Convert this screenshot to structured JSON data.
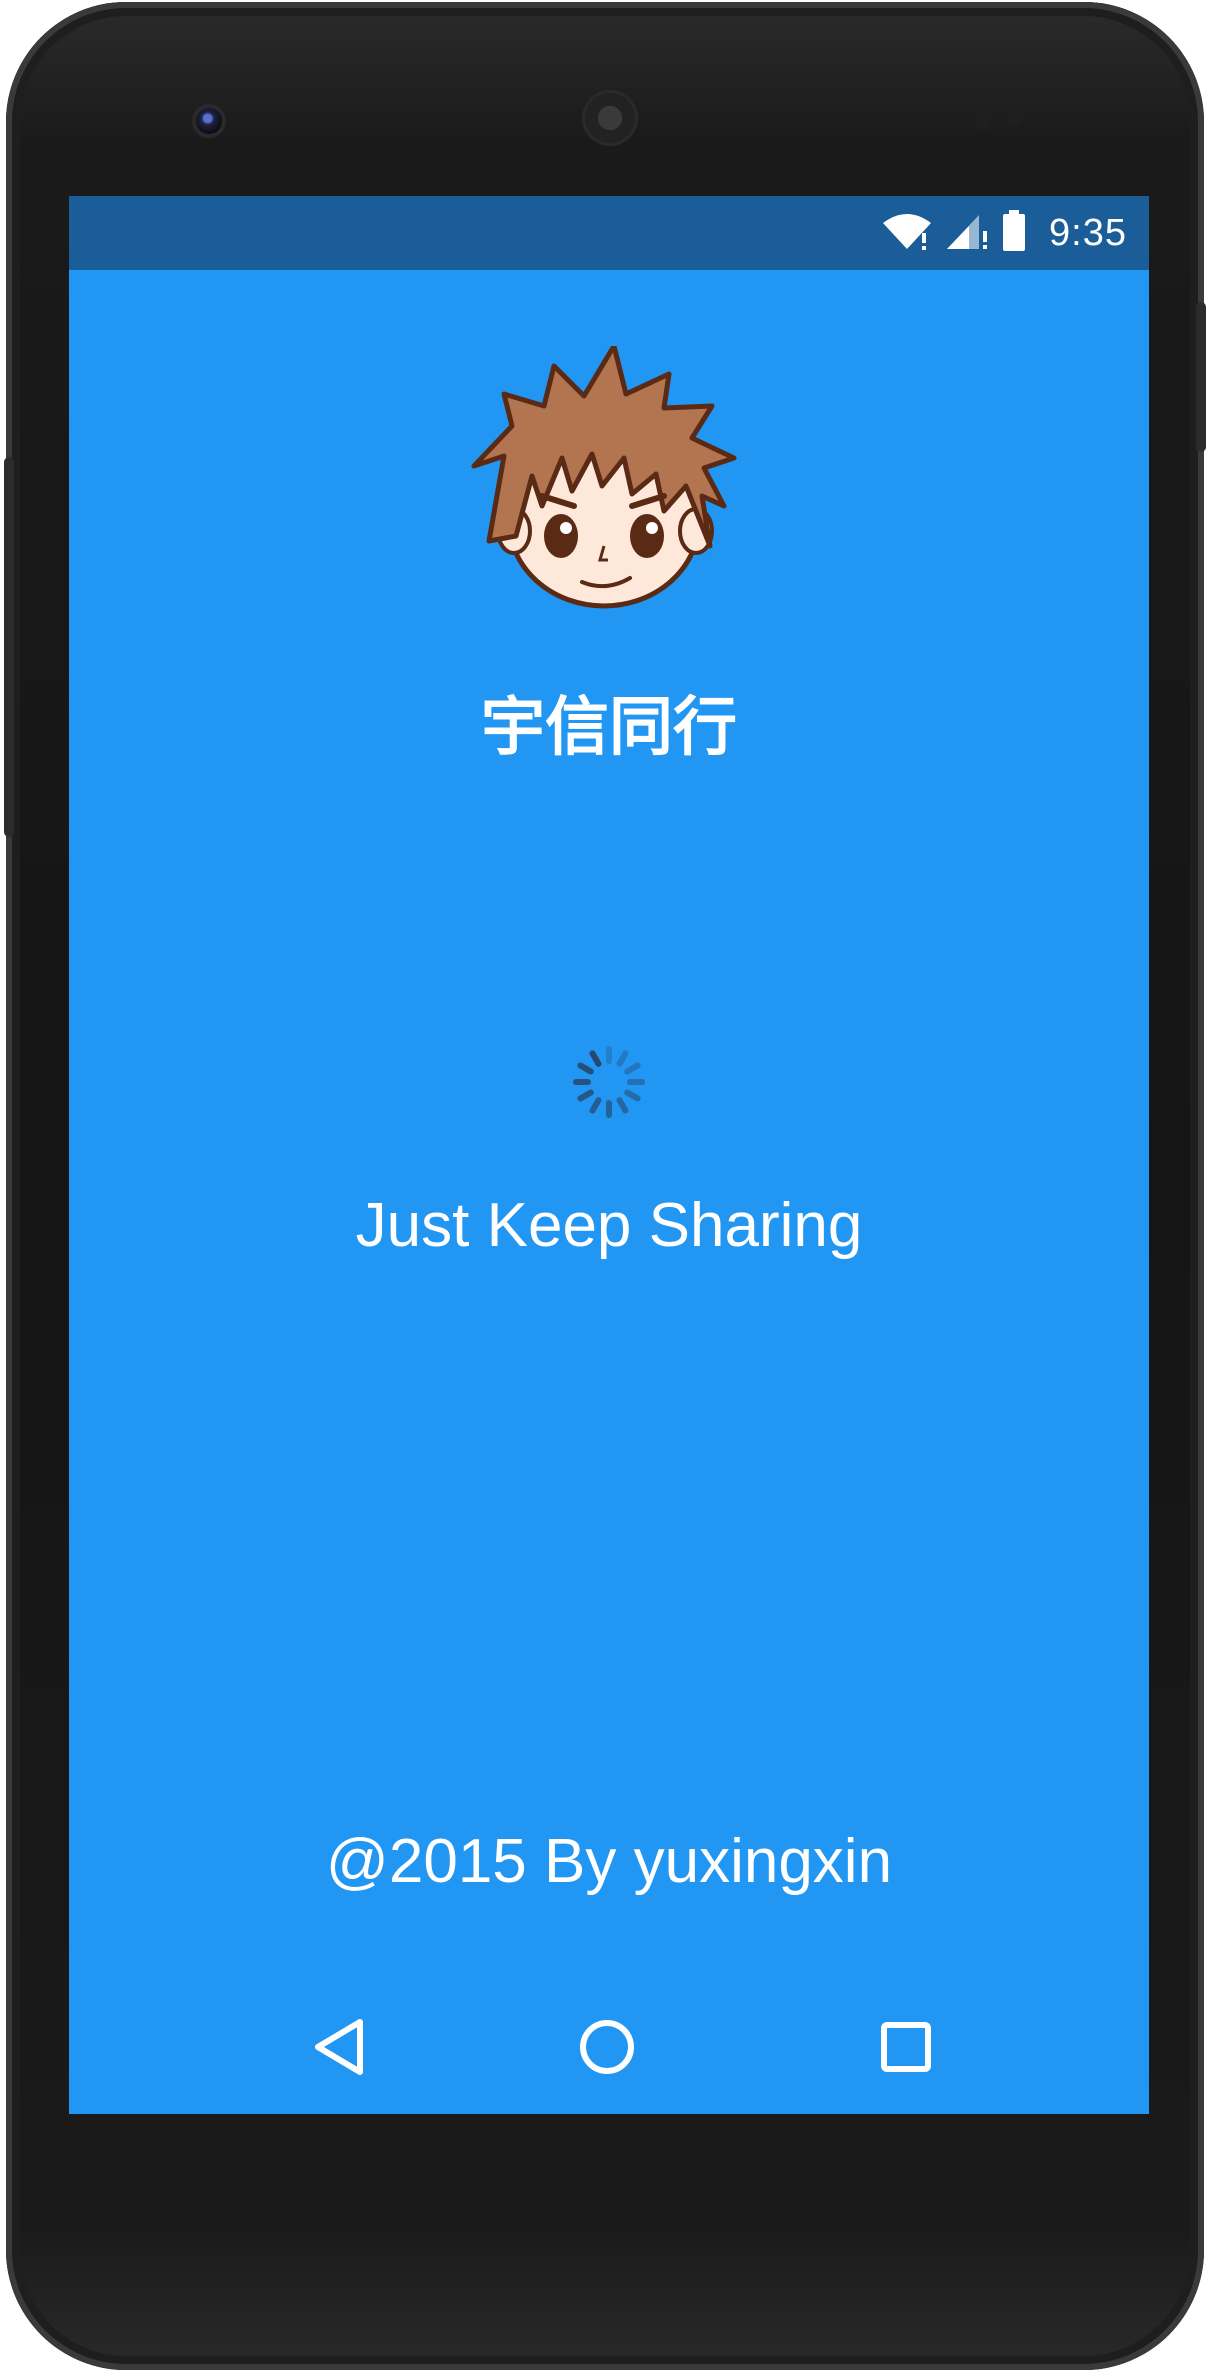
{
  "status_bar": {
    "time": "9:35",
    "icons": [
      "wifi-icon",
      "signal-icon",
      "battery-icon"
    ]
  },
  "app": {
    "title": "宇信同行",
    "tagline": "Just Keep Sharing",
    "copyright": "@2015 By yuxingxin",
    "avatar_icon": "cartoon-boy-avatar",
    "loading_indicator": "spinner"
  },
  "nav_bar": {
    "buttons": [
      "back-icon",
      "home-icon",
      "recents-icon"
    ]
  },
  "colors": {
    "background": "#2196f2",
    "status_bar": "#1a5d98",
    "text": "#ffffff",
    "device_body": "#151515"
  }
}
